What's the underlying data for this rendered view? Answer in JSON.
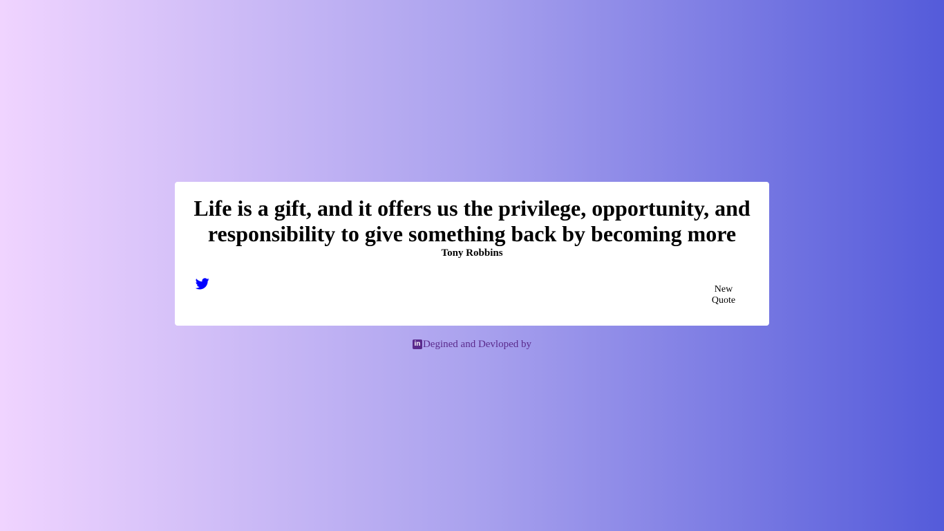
{
  "quote": {
    "text": "Life is a gift, and it offers us the privilege, opportunity, and responsibility to give something back by becoming more",
    "author": "Tony Robbins"
  },
  "actions": {
    "tweet_icon": "twitter-icon",
    "new_quote_label": "New Quote"
  },
  "footer": {
    "icon": "linkedin-icon",
    "icon_glyph": "in",
    "text": "Degined and Devloped by"
  },
  "colors": {
    "gradient_start": "#f0d4ff",
    "gradient_end": "#545bda",
    "twitter_blue": "#0000ff",
    "footer_purple": "#5a2a8c"
  }
}
